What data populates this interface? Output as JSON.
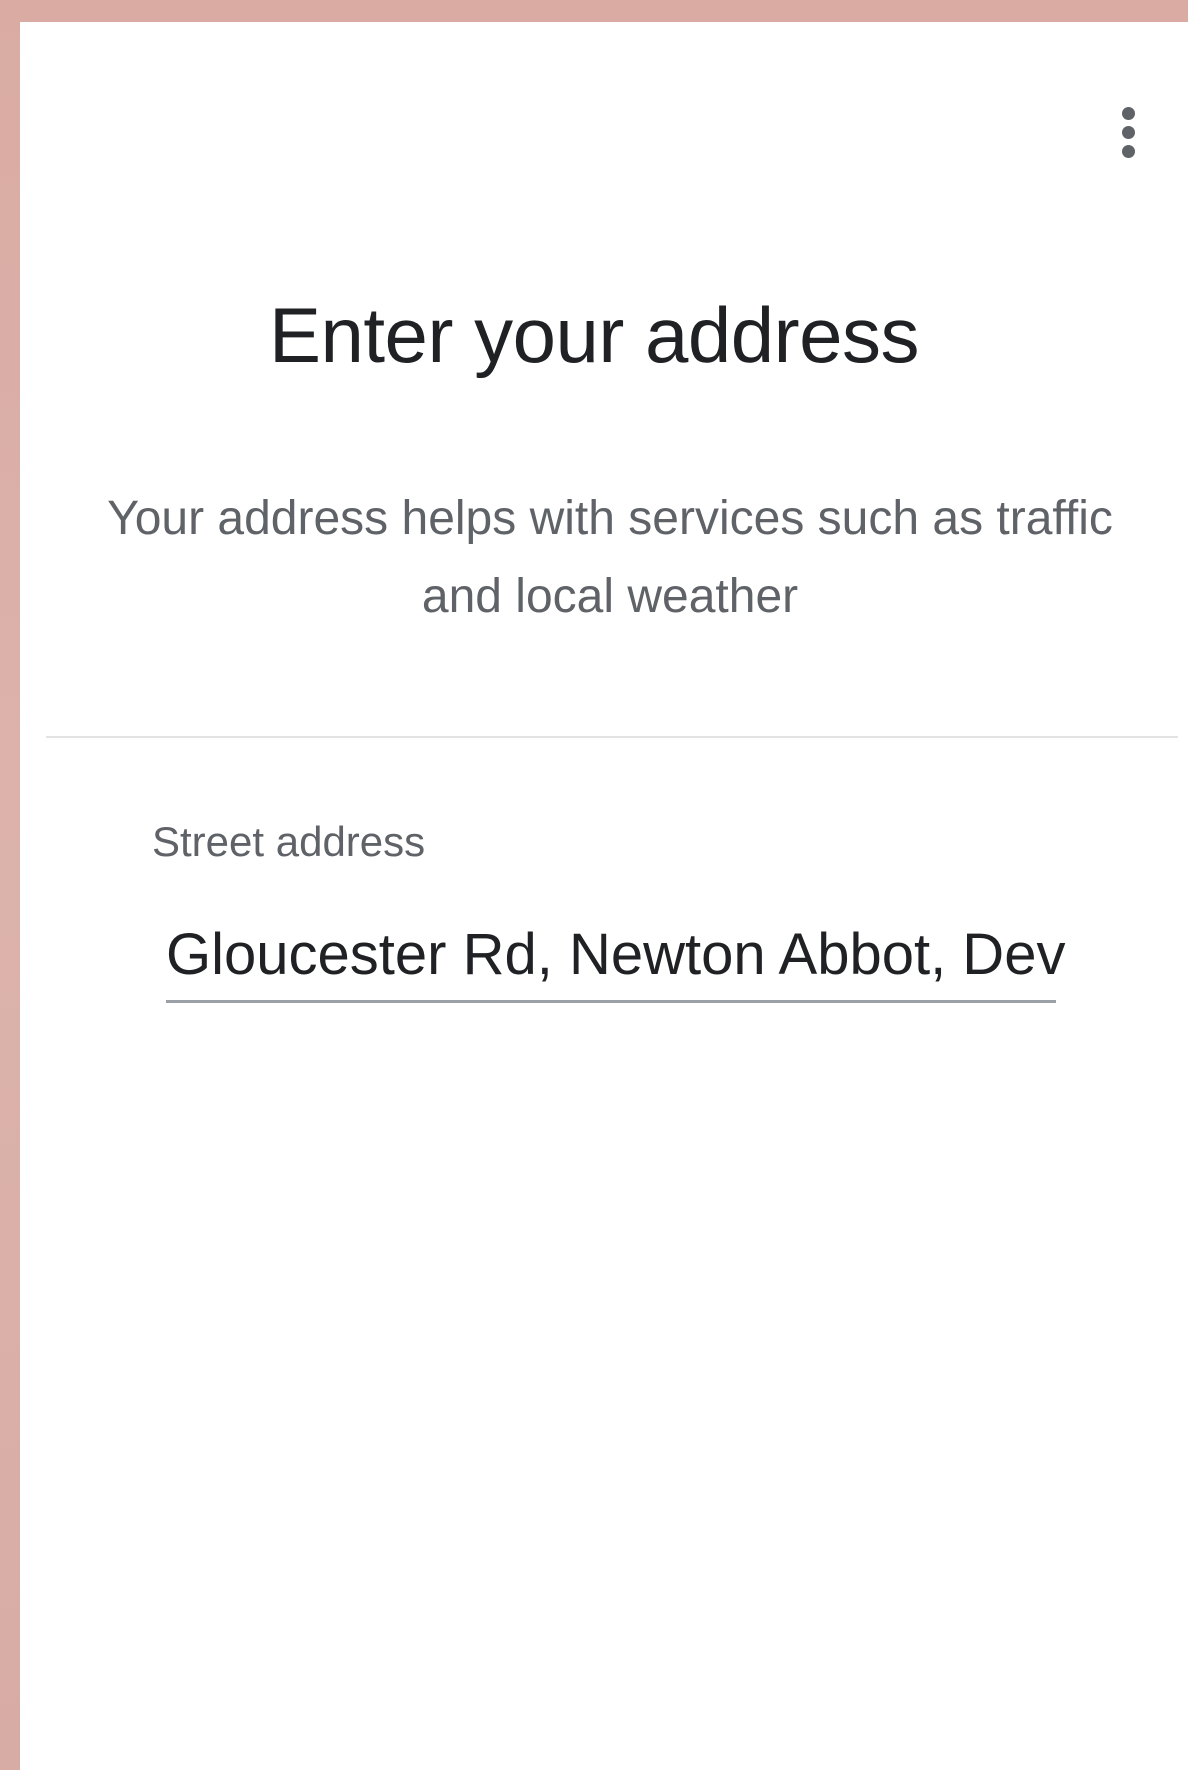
{
  "header": {
    "menu_icon": "more-vert-icon"
  },
  "main": {
    "title": "Enter your address",
    "subtitle": "Your address helps with services such as traffic and local weather"
  },
  "form": {
    "street_address": {
      "label": "Street address",
      "value": "Gloucester Rd, Newton Abbot, Devon"
    }
  },
  "colors": {
    "frame": "#d8aea6",
    "title_text": "#202124",
    "secondary_text": "#5f6368",
    "underline": "#9aa0a6"
  }
}
